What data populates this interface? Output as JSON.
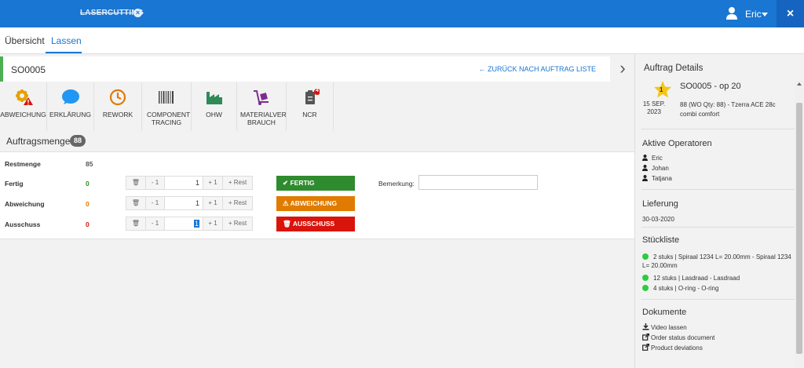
{
  "topbar": {
    "app_title": "LASERCUTTING",
    "user_name": "Eric",
    "close_label": "×"
  },
  "tabs": [
    {
      "label": "Übersicht",
      "active": false
    },
    {
      "label": "Lassen",
      "active": true
    }
  ],
  "order": {
    "id": "SO0005",
    "back_link": "← ZURÜCK NACH AUFTRAG LISTE",
    "accent_color": "#4caf50"
  },
  "toolbar": [
    {
      "label": "ABWEICHUNG",
      "icon": "gear-warning-icon"
    },
    {
      "label": "ERKLÄRUNG",
      "icon": "speech-bubble-icon"
    },
    {
      "label": "REWORK",
      "icon": "clock-icon"
    },
    {
      "label": "COMPONENT TRACING",
      "icon": "barcode-icon"
    },
    {
      "label": "OHW",
      "icon": "factory-icon"
    },
    {
      "label": "MATERIALVER BRAUCH",
      "icon": "hand-truck-icon"
    },
    {
      "label": "NCR",
      "icon": "clipboard-icon",
      "badge": "4"
    }
  ],
  "quantity": {
    "title": "Auftragsmenge",
    "badge": "88",
    "rows": [
      {
        "label": "Restmenge",
        "value": "85",
        "color": "#555555"
      },
      {
        "label": "Fertig",
        "value": "0",
        "color": "#2e8b2e",
        "input": "1",
        "action": "FERTIG"
      },
      {
        "label": "Abweichung",
        "value": "0",
        "color": "#e07b00",
        "input": "1",
        "action": "ABWEICHUNG"
      },
      {
        "label": "Ausschuss",
        "value": "0",
        "color": "#d9140a",
        "input": "1",
        "action": "AUSSCHUSS"
      }
    ],
    "stepper": {
      "minus": "- 1",
      "plus": "+ 1",
      "rest": "+ Rest"
    },
    "remark_label": "Bemerkung:",
    "remark_value": ""
  },
  "side": {
    "title": "Auftrag Details",
    "star_number": "1",
    "order_label": "SO0005 - op 20",
    "date_line1": "15 SEP.",
    "date_line2": "2023",
    "description": "88 (WO Qty: 88) - Tzerra ACE 28c combi comfort",
    "operators_title": "Aktive Operatoren",
    "operators": [
      "Eric",
      "Johan",
      "Tatjana"
    ],
    "delivery_title": "Lieferung",
    "delivery_date": "30-03-2020",
    "bom_title": "Stückliste",
    "bom": [
      "2 stuks | Spiraal 1234 L= 20.00mm - Spiraal 1234 L= 20.00mm",
      "12 stuks | Lasdraad - Lasdraad",
      "4 stuks | O-ring - O-ring"
    ],
    "docs_title": "Dokumente",
    "docs": [
      {
        "label": "Video lassen",
        "icon": "download-icon"
      },
      {
        "label": "Order status document",
        "icon": "external-link-icon"
      },
      {
        "label": "Product deviations",
        "icon": "external-link-icon"
      }
    ]
  }
}
